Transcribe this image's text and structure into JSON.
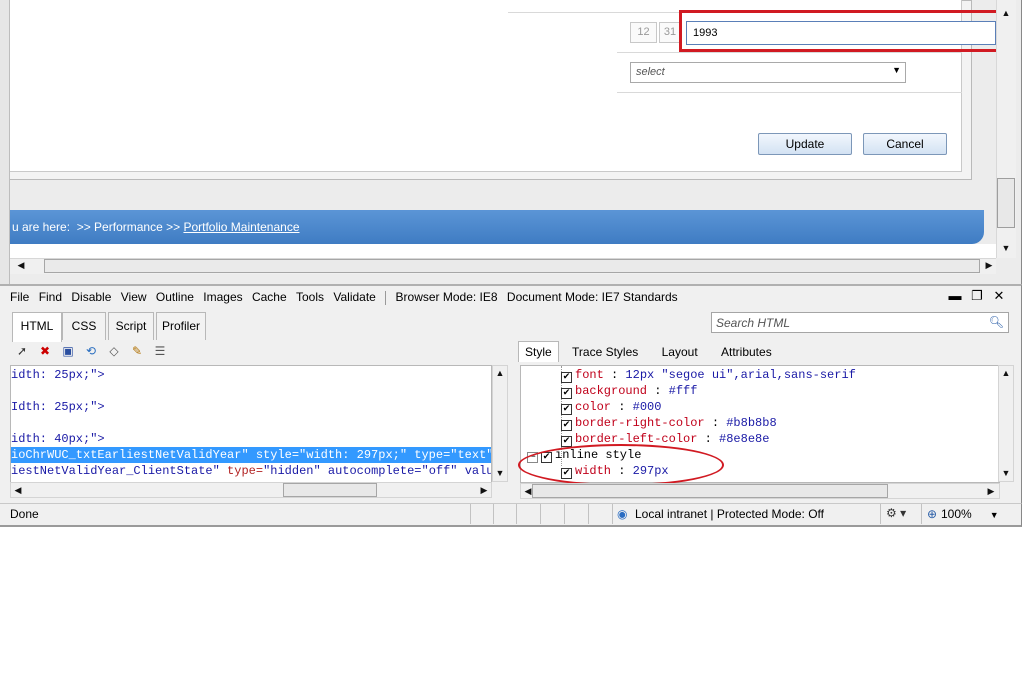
{
  "form": {
    "date_month": "12",
    "date_day": "31",
    "year_value": "1993",
    "select_placeholder": "select",
    "update_label": "Update",
    "cancel_label": "Cancel"
  },
  "breadcrumb": {
    "prefix": "u are here:  >> Performance >> ",
    "link": "Portfolio Maintenance"
  },
  "devtools": {
    "menu": [
      "File",
      "Find",
      "Disable",
      "View",
      "Outline",
      "Images",
      "Cache",
      "Tools",
      "Validate"
    ],
    "browser_mode": "Browser Mode: IE8",
    "document_mode": "Document Mode: IE7 Standards",
    "tabs": [
      "HTML",
      "CSS",
      "Script",
      "Profiler"
    ],
    "active_tab": "HTML",
    "search_placeholder": "Search HTML",
    "style_tabs": [
      "Style",
      "Trace Styles",
      "Layout",
      "Attributes"
    ],
    "code_lines": [
      {
        "a": "idth: 25px;\">",
        "b": "",
        "c": ""
      },
      {
        "a": "",
        "b": "",
        "c": ""
      },
      {
        "a": "Idth: 25px;\">",
        "b": "",
        "c": ""
      },
      {
        "a": "",
        "b": "",
        "c": ""
      },
      {
        "a": "idth: 40px;\">",
        "b": "",
        "c": ""
      },
      {
        "a": "ioChrWUC_txtEarliestNetValidYear\" style=\"width: 297px;\" type=\"text\" s",
        "b": "",
        "c": ""
      },
      {
        "a": "iestNetValidYear_ClientState\" ",
        "b": "type=",
        "c": "\"hidden\" autocomplete=\"off\" value="
      }
    ],
    "style_rules": [
      {
        "prop": "font",
        "val": "12px \"segoe ui\",arial,sans-serif"
      },
      {
        "prop": "background",
        "val": "#fff"
      },
      {
        "prop": "color",
        "val": "#000"
      },
      {
        "prop": "border-right-color",
        "val": "#b8b8b8"
      },
      {
        "prop": "border-left-color",
        "val": "#8e8e8e"
      }
    ],
    "inline_header": "inline style",
    "inline_rule": {
      "prop": "width",
      "val": "297px"
    }
  },
  "statusbar": {
    "status": "Done",
    "zone": "Local intranet | Protected Mode: Off",
    "zoom": "100%"
  },
  "colors": {
    "annotation_red": "#d11a22",
    "selection_blue": "#3399ff",
    "breadcrumb_blue": "#4a86cb"
  }
}
